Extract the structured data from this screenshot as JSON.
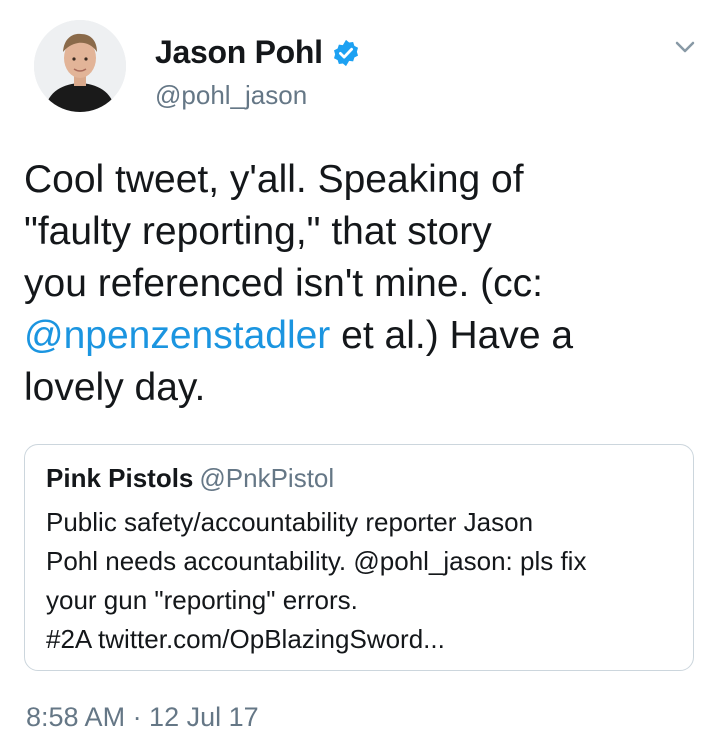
{
  "author": {
    "display_name": "Jason Pohl",
    "handle": "@pohl_jason"
  },
  "tweet": {
    "lines": [
      "Cool tweet, y'all. Speaking of",
      "\"faulty reporting,\" that story",
      "you referenced isn't mine. (cc:",
      "et al.) Have a",
      "lovely day."
    ],
    "mention": "@npenzenstadler"
  },
  "quoted_tweet": {
    "display_name": "Pink Pistols",
    "handle": "@PnkPistol",
    "lines": [
      "Public safety/accountability reporter Jason",
      "Pohl needs accountability. @pohl_jason: pls fix",
      "your gun \"reporting\" errors.",
      "#2A twitter.com/OpBlazingSword..."
    ]
  },
  "timestamp": "8:58 AM · 12 Jul 17",
  "colors": {
    "link": "#1b95e0",
    "verified": "#1da1f2",
    "secondary_text": "#657786",
    "border": "#ccd6dd"
  },
  "icons": {
    "verified": "verified-badge-icon",
    "menu": "chevron-down-icon"
  }
}
